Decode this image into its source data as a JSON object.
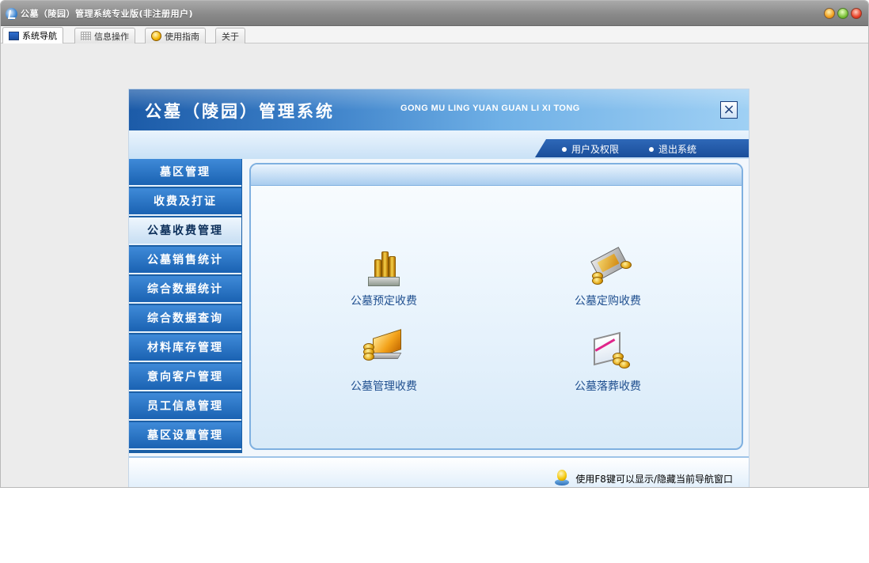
{
  "window": {
    "title": "公墓（陵园）管理系统专业版(非注册用户)",
    "buttons": [
      "minimize",
      "maximize",
      "close"
    ]
  },
  "tabs": [
    {
      "label": "系统导航",
      "icon": "monitor-icon",
      "active": true
    },
    {
      "label": "信息操作",
      "icon": "grid-icon",
      "active": false
    },
    {
      "label": "使用指南",
      "icon": "help-icon",
      "active": false
    },
    {
      "label": "关于",
      "icon": "",
      "active": false
    }
  ],
  "banner": {
    "title": "公墓（陵园）管理系统",
    "subtitle": "GONG MU LING YUAN GUAN LI XI TONG",
    "close_label": "×"
  },
  "toplinks": [
    {
      "label": "用户及权限"
    },
    {
      "label": "退出系统"
    }
  ],
  "sidebar": {
    "items": [
      {
        "label": "墓区管理"
      },
      {
        "label": "收费及打证"
      },
      {
        "label": "公墓收费管理",
        "active": true
      },
      {
        "label": "公墓销售统计"
      },
      {
        "label": "综合数据统计"
      },
      {
        "label": "综合数据查询"
      },
      {
        "label": "材料库存管理"
      },
      {
        "label": "意向客户管理"
      },
      {
        "label": "员工信息管理"
      },
      {
        "label": "墓区设置管理"
      }
    ]
  },
  "operations": [
    {
      "label": "公墓预定收费",
      "icon": "coin-stack-icon"
    },
    {
      "label": "公墓定购收费",
      "icon": "wallet-coins-icon"
    },
    {
      "label": "公墓管理收费",
      "icon": "laptop-coins-icon"
    },
    {
      "label": "公墓落葬收费",
      "icon": "chart-coins-icon"
    }
  ],
  "footer": {
    "tip": "使用F8键可以显示/隐藏当前导航窗口",
    "tip_icon": "lightbulb-icon"
  },
  "colors": {
    "banner_dark": "#1c5ba8",
    "sidebar_blue": "#1a62b2",
    "active_item_text": "#0c2f5a",
    "link_blue": "#1f4f8f"
  }
}
